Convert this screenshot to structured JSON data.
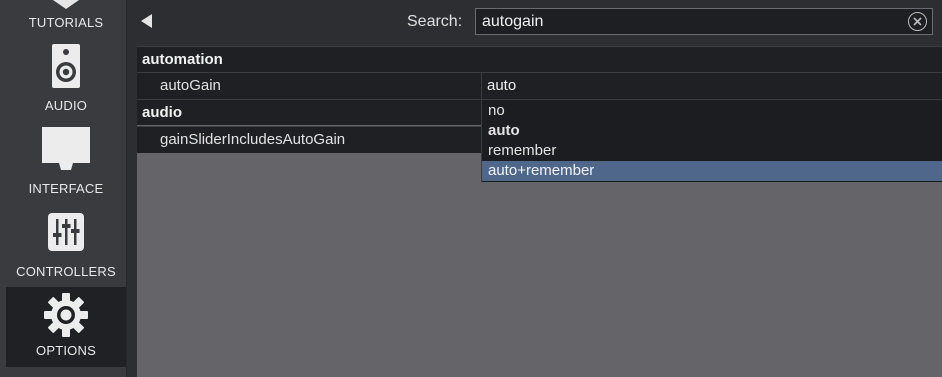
{
  "sidebar": {
    "items": [
      {
        "label": "TUTORIALS",
        "icon": "tutorials-icon"
      },
      {
        "label": "AUDIO",
        "icon": "speaker-icon"
      },
      {
        "label": "INTERFACE",
        "icon": "monitor-icon"
      },
      {
        "label": "CONTROLLERS",
        "icon": "sliders-icon"
      },
      {
        "label": "OPTIONS",
        "icon": "gear-icon",
        "active": true
      }
    ]
  },
  "search": {
    "label": "Search:",
    "value": "autogain"
  },
  "groups": [
    {
      "title": "automation",
      "rows": [
        {
          "name": "autoGain",
          "value": "auto"
        }
      ]
    },
    {
      "title": "audio",
      "rows": [
        {
          "name": "gainSliderIncludesAutoGain",
          "value": ""
        }
      ]
    }
  ],
  "dropdown": {
    "options": [
      {
        "label": "no"
      },
      {
        "label": "auto",
        "current": true
      },
      {
        "label": "remember"
      },
      {
        "label": "auto+remember",
        "highlighted": true
      }
    ]
  },
  "colors": {
    "sidebar_bg": "#3a3b3f",
    "active_bg": "#202124",
    "row_bg": "#1f2023",
    "content_bg": "#646469",
    "highlight": "#50678c"
  }
}
